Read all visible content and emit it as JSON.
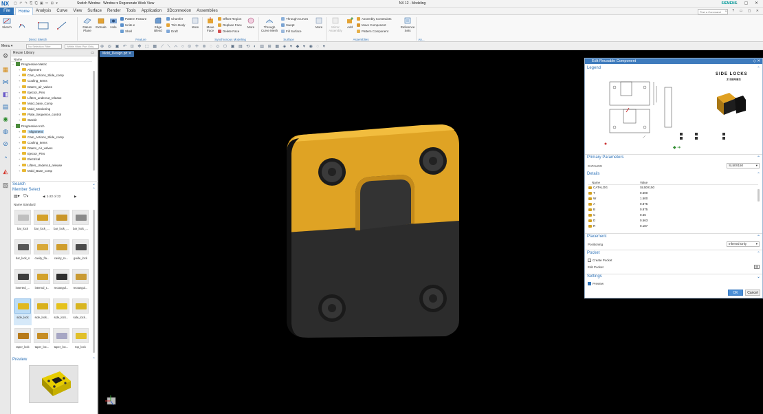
{
  "titlebar": {
    "app_badge": "NX",
    "switch_window": "Switch Window",
    "window_menu": "Window ▾ Regenerate Work View",
    "title": "NX 12 - Modeling",
    "brand": "SIEMENS"
  },
  "menubar": {
    "file": "File",
    "tabs": [
      "Home",
      "Analysis",
      "Curve",
      "View",
      "Surface",
      "Render",
      "Tools",
      "Application",
      "3Dconnexion",
      "Assemblies"
    ],
    "command_finder_placeholder": "Find a Command"
  },
  "ribbon": {
    "sketch": "Sketch",
    "datum_plane": "Datum\nPlane",
    "extrude": "Extrude",
    "hole": "Hole",
    "pattern_feature": "Pattern Feature",
    "unite": "Unite",
    "shell": "Shell",
    "edge_blend": "Edge\nBlend",
    "chamfer": "Chamfer",
    "trim_body": "Trim Body",
    "draft": "Draft",
    "more1": "More",
    "move_face": "Move\nFace",
    "offset_region": "Offset Region",
    "replace_face": "Replace Face",
    "delete_face": "Delete Face",
    "more2": "More",
    "through_curve_mesh": "Through\nCurve Mesh",
    "through_curves": "Through Curves",
    "swept": "Swept",
    "fill_surface": "Fill Surface",
    "more3": "More",
    "mirror_assembly": "Mirror\nAssembly",
    "add": "Add",
    "assembly_constraints": "Assembly Constraints",
    "move_component": "Move Component",
    "pattern_component": "Pattern Component",
    "reference_sets": "Reference\nSets",
    "groups": {
      "direct_sketch": "Direct Sketch",
      "feature": "Feature",
      "synchronous_modeling": "Synchronous Modeling",
      "surface": "Surface",
      "assemblies": "Assemblies",
      "an": "An..."
    }
  },
  "toolbar2": {
    "menu": "Menu ▾",
    "filter": "No Selection Filter",
    "scope": "Within Work Part Only"
  },
  "reuse_library": {
    "title": "Reuse Library",
    "tree_header": "Name",
    "tree": [
      {
        "label": "Progressive Metric",
        "level": 0,
        "type": "lib",
        "expanded": true
      },
      {
        "label": "Alignment",
        "level": 1,
        "type": "folder"
      },
      {
        "label": "Cam_Actions_Slide_comp",
        "level": 1,
        "type": "folder"
      },
      {
        "label": "Cooling_Items",
        "level": 1,
        "type": "folder"
      },
      {
        "label": "Daters_air_valves",
        "level": 1,
        "type": "folder"
      },
      {
        "label": "Ejector_Pins",
        "level": 1,
        "type": "folder"
      },
      {
        "label": "Lifters_undercut_release",
        "level": 1,
        "type": "folder"
      },
      {
        "label": "Mold_base_Comp",
        "level": 1,
        "type": "folder"
      },
      {
        "label": "Mold_Monitoring",
        "level": 1,
        "type": "folder"
      },
      {
        "label": "Plate_Sequence_control",
        "level": 1,
        "type": "folder"
      },
      {
        "label": "Stackit",
        "level": 1,
        "type": "folder"
      },
      {
        "label": "Progressive Inch",
        "level": 0,
        "type": "lib",
        "expanded": true
      },
      {
        "label": "Alignment",
        "level": 1,
        "type": "folder",
        "selected": true
      },
      {
        "label": "Cam_Actions_Slide_comp",
        "level": 1,
        "type": "folder"
      },
      {
        "label": "Cooling_Items",
        "level": 1,
        "type": "folder"
      },
      {
        "label": "Daters_Air_valves",
        "level": 1,
        "type": "folder"
      },
      {
        "label": "Ejector_Pins",
        "level": 1,
        "type": "folder"
      },
      {
        "label": "Electrical",
        "level": 1,
        "type": "folder"
      },
      {
        "label": "Lifters_Undercut_release",
        "level": 1,
        "type": "folder"
      },
      {
        "label": "Mold_Base_comp",
        "level": 1,
        "type": "folder"
      }
    ],
    "search": "Search",
    "member_select": "Member Select",
    "pager": "1-22 of 22",
    "grid_header": "Name  Standard",
    "members": [
      {
        "label": "bar_lock",
        "color": "#bfbfbf"
      },
      {
        "label": "bar_lock_...",
        "color": "#d4a12a"
      },
      {
        "label": "bar_lock_...",
        "color": "#c9962a"
      },
      {
        "label": "bar_lock_...",
        "color": "#8a8a8a"
      },
      {
        "label": "bar_lock_s",
        "color": "#555555"
      },
      {
        "label": "cavity_fla...",
        "color": "#d8a93a"
      },
      {
        "label": "cavity_ro...",
        "color": "#cf9d2c"
      },
      {
        "label": "guide_lock",
        "color": "#4a4a4a"
      },
      {
        "label": "inserted_...",
        "color": "#3e3e3e"
      },
      {
        "label": "internal_t...",
        "color": "#d3a22b"
      },
      {
        "label": "rectangul...",
        "color": "#2e2e2e"
      },
      {
        "label": "rectangul...",
        "color": "#c99a33"
      },
      {
        "label": "side_lock",
        "color": "#e0b81f",
        "selected": true
      },
      {
        "label": "side_lock...",
        "color": "#d9b11c"
      },
      {
        "label": "side_lock...",
        "color": "#e5c21b"
      },
      {
        "label": "side_lock...",
        "color": "#d8b520"
      },
      {
        "label": "taper_lock",
        "color": "#b77a1a"
      },
      {
        "label": "taper_loc...",
        "color": "#c68d24"
      },
      {
        "label": "taper_loc...",
        "color": "#a7a7c4"
      },
      {
        "label": "top_lock",
        "color": "#e1c02a"
      }
    ],
    "preview": "Preview"
  },
  "viewport": {
    "doc_tab": "Mold_Design.prt"
  },
  "dialog": {
    "title": "Edit Reusable Component",
    "legend": "Legend",
    "legend_brand": "SIDE LOCKS",
    "legend_series": "Z-SERIES",
    "primary_parameters": "Primary Parameters",
    "catalog_label": "CATALOG",
    "catalog_value": "SL50X150",
    "details": "Details",
    "details_header": {
      "name": "Name",
      "value": "Value"
    },
    "details_rows": [
      {
        "name": "CATALOG",
        "value": "SL50X150"
      },
      {
        "name": "T",
        "value": "0.500"
      },
      {
        "name": "W",
        "value": "1.500"
      },
      {
        "name": "A",
        "value": "0.875"
      },
      {
        "name": "B",
        "value": "0.875"
      },
      {
        "name": "C",
        "value": "0.56"
      },
      {
        "name": "D",
        "value": "0.563"
      },
      {
        "name": "R",
        "value": "0.187"
      }
    ],
    "placement": "Placement",
    "positioning_label": "Positioning",
    "positioning_value": "Inferred Only",
    "pocket": "Pocket",
    "create_pocket": "Create Pocket",
    "edit_pocket": "Edit Pocket",
    "settings": "Settings",
    "preview": "Preview",
    "ok": "OK",
    "cancel": "Cancel"
  }
}
